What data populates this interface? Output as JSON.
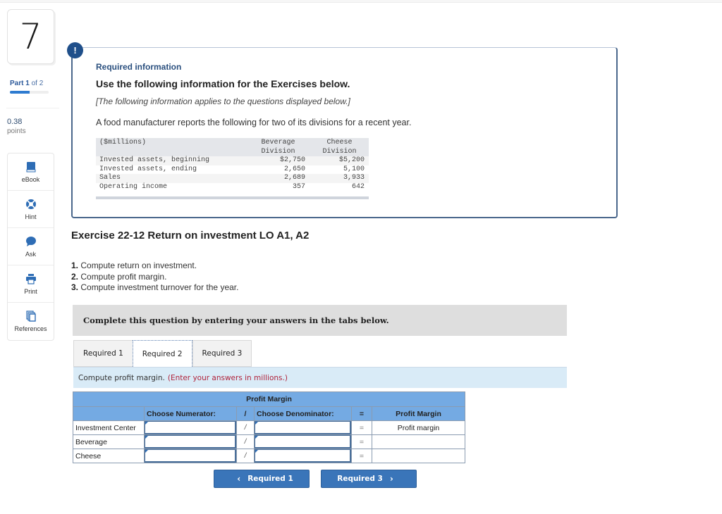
{
  "question": {
    "number": "7",
    "part_label": "Part",
    "part_current": "1",
    "part_total_text": "of 2",
    "part_progress": 0.5,
    "score": "0.38",
    "score_label": "points"
  },
  "tools": [
    {
      "label": "eBook",
      "icon": "book-icon"
    },
    {
      "label": "Hint",
      "icon": "lifebuoy-icon"
    },
    {
      "label": "Ask",
      "icon": "speech-bubble-icon"
    },
    {
      "label": "Print",
      "icon": "printer-icon"
    },
    {
      "label": "References",
      "icon": "documents-icon"
    }
  ],
  "info": {
    "badge": "!",
    "heading": "Required information",
    "subheading": "Use the following information for the Exercises below.",
    "applies": "[The following information applies to the questions displayed below.]",
    "intro": "A food manufacturer reports the following for two of its divisions for a recent year.",
    "table": {
      "unit_label": "($millions)",
      "col1_line1": "Beverage",
      "col1_line2": "Division",
      "col2_line1": "Cheese",
      "col2_line2": "Division",
      "rows": [
        {
          "label": "Invested assets, beginning",
          "beverage": "$2,750",
          "cheese": "$5,200"
        },
        {
          "label": "Invested assets, ending",
          "beverage": "2,650",
          "cheese": "5,100"
        },
        {
          "label": "Sales",
          "beverage": "2,689",
          "cheese": "3,933"
        },
        {
          "label": "Operating income",
          "beverage": "357",
          "cheese": "642"
        }
      ]
    }
  },
  "exercise": {
    "title": "Exercise 22-12 Return on investment LO A1, A2",
    "steps": [
      {
        "num": "1.",
        "text": " Compute return on investment."
      },
      {
        "num": "2.",
        "text": " Compute profit margin."
      },
      {
        "num": "3.",
        "text": " Compute investment turnover for the year."
      }
    ]
  },
  "instructions": "Complete this question by entering your answers in the tabs below.",
  "tabs": [
    {
      "label": "Required 1",
      "active": false
    },
    {
      "label": "Required 2",
      "active": true
    },
    {
      "label": "Required 3",
      "active": false
    }
  ],
  "prompt": {
    "text": "Compute profit margin.",
    "note": "(Enter your answers in millions.)"
  },
  "grid": {
    "title": "Profit Margin",
    "headers": {
      "label": "",
      "numerator": "Choose Numerator:",
      "divide": "/",
      "denominator": "Choose Denominator:",
      "equals": "=",
      "result": "Profit Margin"
    },
    "rows": [
      {
        "label": "Investment Center",
        "numerator": "",
        "op": "/",
        "denominator": "",
        "eq": "=",
        "result": "Profit margin"
      },
      {
        "label": "Beverage",
        "numerator": "",
        "op": "/",
        "denominator": "",
        "eq": "=",
        "result": ""
      },
      {
        "label": "Cheese",
        "numerator": "",
        "op": "/",
        "denominator": "",
        "eq": "=",
        "result": ""
      }
    ]
  },
  "nav": {
    "prev_label": "Required 1",
    "next_label": "Required 3",
    "prev_icon": "‹",
    "next_icon": "›"
  }
}
